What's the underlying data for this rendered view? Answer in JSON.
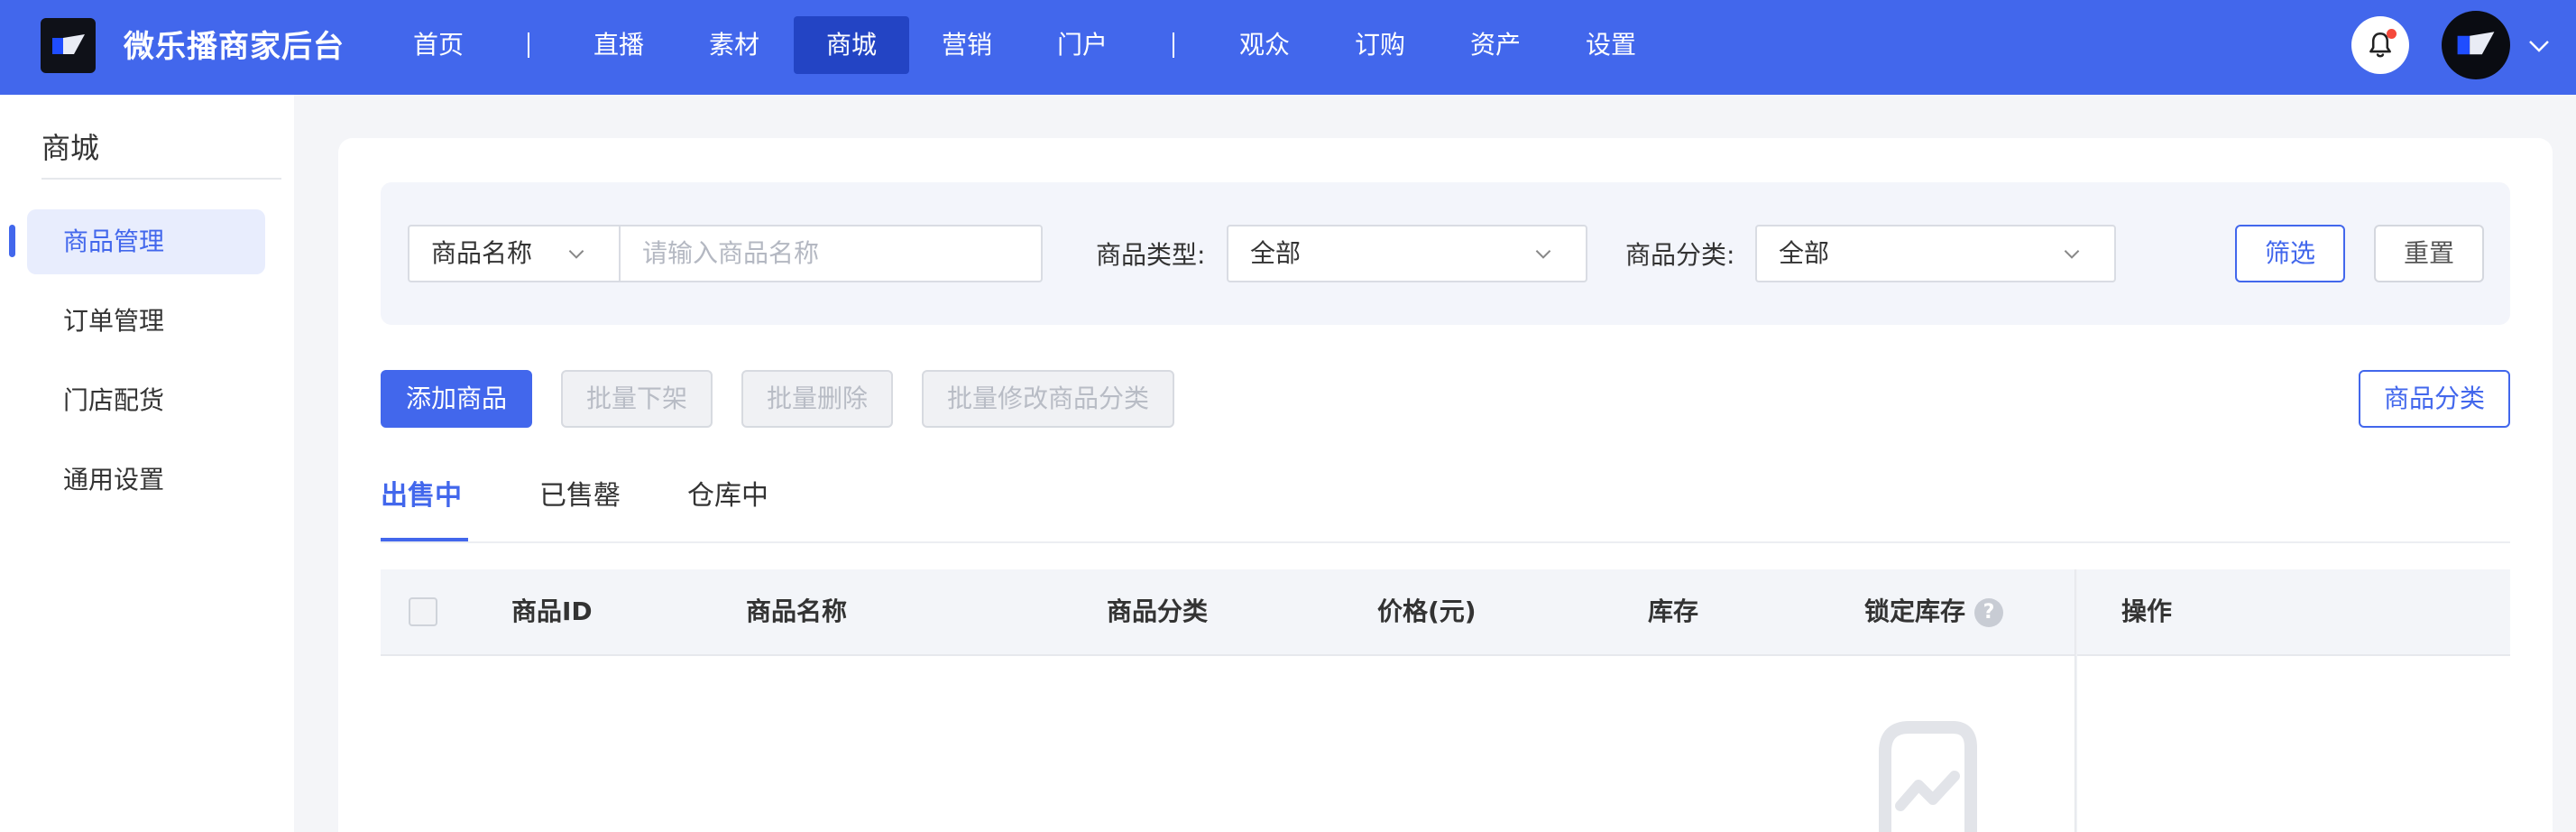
{
  "app": {
    "title": "微乐播商家后台"
  },
  "nav": {
    "items": [
      {
        "label": "首页"
      },
      {
        "label": "直播"
      },
      {
        "label": "素材"
      },
      {
        "label": "商城",
        "active": true
      },
      {
        "label": "营销"
      },
      {
        "label": "门户"
      },
      {
        "label": "观众"
      },
      {
        "label": "订购"
      },
      {
        "label": "资产"
      },
      {
        "label": "设置"
      }
    ],
    "separator": "|"
  },
  "sidebar": {
    "title": "商城",
    "items": [
      {
        "label": "商品管理",
        "active": true
      },
      {
        "label": "订单管理"
      },
      {
        "label": "门店配货"
      },
      {
        "label": "通用设置"
      }
    ]
  },
  "filters": {
    "field_select": "商品名称",
    "search_placeholder": "请输入商品名称",
    "type_label": "商品类型:",
    "type_value": "全部",
    "category_label": "商品分类:",
    "category_value": "全部",
    "filter_button": "筛选",
    "reset_button": "重置"
  },
  "actions": {
    "add": "添加商品",
    "batch_off_shelf": "批量下架",
    "batch_delete": "批量删除",
    "batch_edit_category": "批量修改商品分类",
    "category_button": "商品分类"
  },
  "tabs": [
    {
      "label": "出售中",
      "active": true
    },
    {
      "label": "已售罄"
    },
    {
      "label": "仓库中"
    }
  ],
  "table": {
    "columns": [
      "商品ID",
      "商品名称",
      "商品分类",
      "价格(元)",
      "库存",
      "锁定库存",
      "操作"
    ],
    "help_glyph": "?"
  },
  "colors": {
    "primary": "#4267ec",
    "nav_active": "#2344c4",
    "notification_dot": "#f5493b"
  },
  "icons": {
    "bell": "bell-icon",
    "chevron": "chevron-down-icon",
    "help": "question-icon",
    "empty": "empty-state-icon"
  }
}
